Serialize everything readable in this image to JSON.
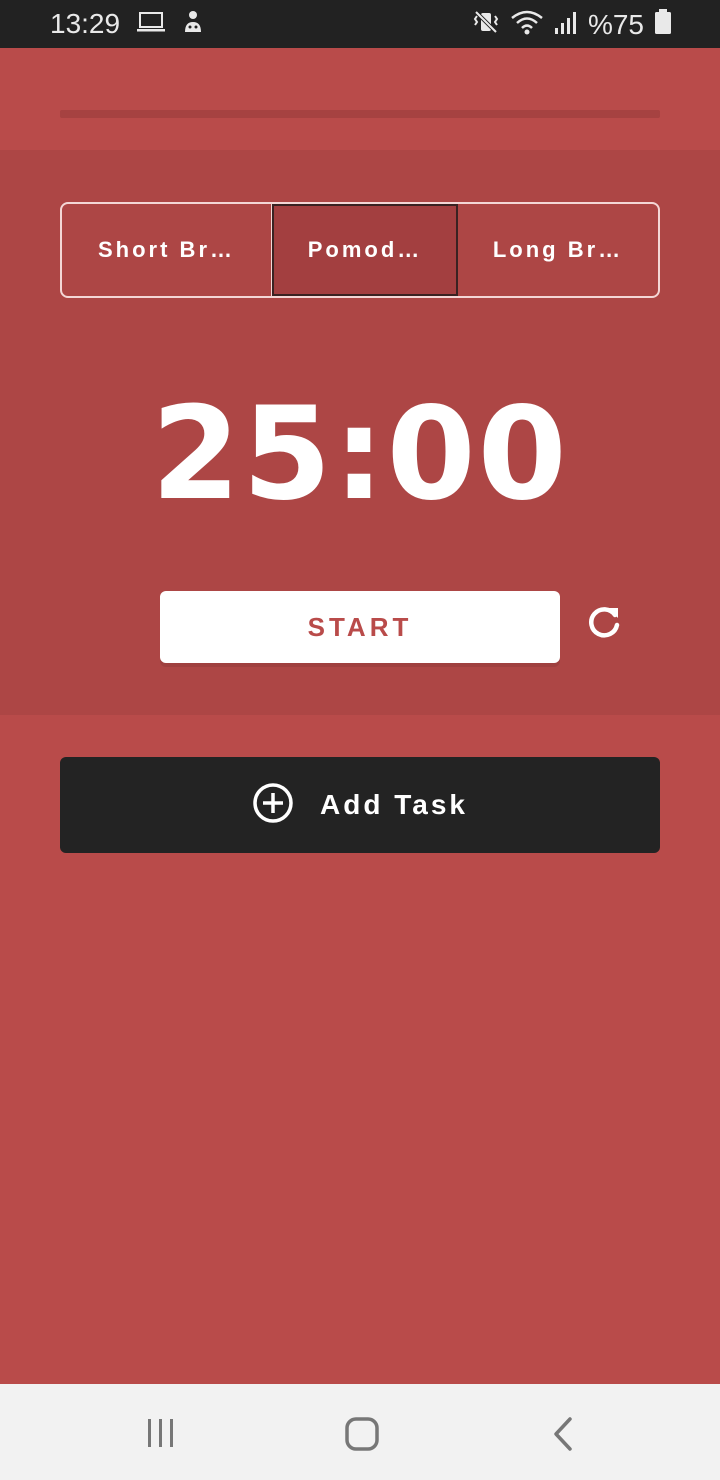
{
  "status_bar": {
    "time": "13:29",
    "battery_text": "%75",
    "left_icons": [
      "laptop-icon",
      "android-debug-icon"
    ],
    "right_icons": [
      "vibrate-mute-icon",
      "wifi-icon",
      "signal-icon",
      "battery-icon"
    ]
  },
  "progress": {
    "value": 0
  },
  "tabs": [
    {
      "label": "Short Br…",
      "selected": false
    },
    {
      "label": "Pomod…",
      "selected": true
    },
    {
      "label": "Long Br…",
      "selected": false
    }
  ],
  "timer": {
    "display": "25:00"
  },
  "controls": {
    "start_label": "START",
    "reset_icon": "refresh-icon"
  },
  "tasks": {
    "add_label": "Add Task",
    "add_icon": "plus-circle-icon"
  },
  "navigation": {
    "items": [
      "recent-apps-icon",
      "home-icon",
      "back-icon"
    ]
  },
  "colors": {
    "background": "#b94b4a",
    "panel": "#ad4645",
    "accent": "#b94b4a",
    "dark_button": "#232323"
  }
}
